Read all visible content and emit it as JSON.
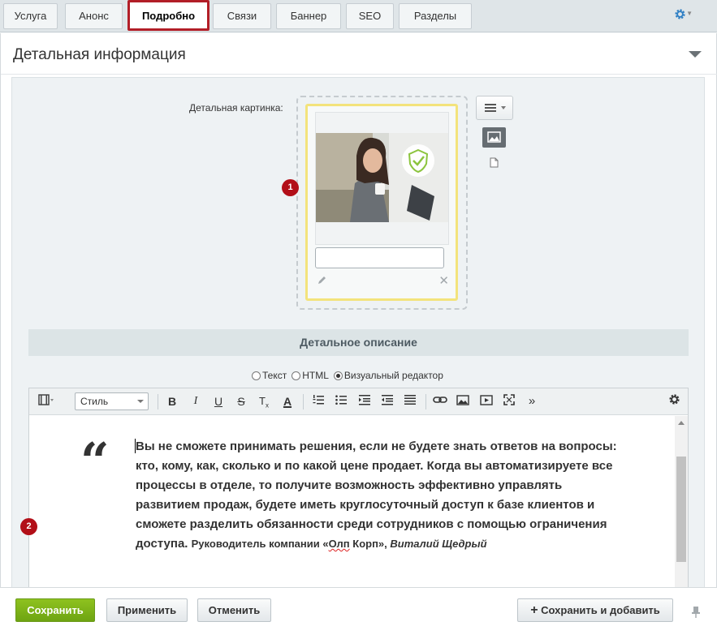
{
  "tabs": [
    {
      "label": "Услуга",
      "active": false
    },
    {
      "label": "Анонс",
      "active": false
    },
    {
      "label": "Подробно",
      "active": true
    },
    {
      "label": "Связи",
      "active": false
    },
    {
      "label": "Баннер",
      "active": false
    },
    {
      "label": "SEO",
      "active": false
    },
    {
      "label": "Разделы",
      "active": false
    }
  ],
  "section": {
    "title": "Детальная информация",
    "image_label": "Детальная картинка:",
    "badge1": "1",
    "badge2": "2"
  },
  "description": {
    "header": "Детальное описание",
    "modes": [
      {
        "label": "Текст",
        "checked": false
      },
      {
        "label": "HTML",
        "checked": false
      },
      {
        "label": "Визуальный редактор",
        "checked": true
      }
    ]
  },
  "editor": {
    "style_select": "Стиль",
    "quote_mark": "“",
    "quote_text": "Вы не сможете принимать решения, если не будете знать ответов на вопросы: кто, кому, как, сколько и по какой цене продает. Когда вы автоматизируете все процессы в отделе, то получите возможность эффективно управлять развитием продаж, будете иметь круглосуточный доступ к базе клиентов и сможете разделить обязанности среди сотрудников с помощью ограничения доступа.",
    "caption_prefix": "Руководитель компании «",
    "caption_company": "Олп",
    "caption_mid": " Корп», ",
    "caption_author": "Виталий Щедрый"
  },
  "footer": {
    "save": "Сохранить",
    "apply": "Применить",
    "cancel": "Отменить",
    "save_add": "Сохранить и добавить"
  },
  "colors": {
    "active_tab_border": "#b21e27",
    "badge": "#b20f18",
    "save_button": "#7db51a",
    "image_card_border": "#f3e37c",
    "settings_icon": "#2f7fc4"
  }
}
